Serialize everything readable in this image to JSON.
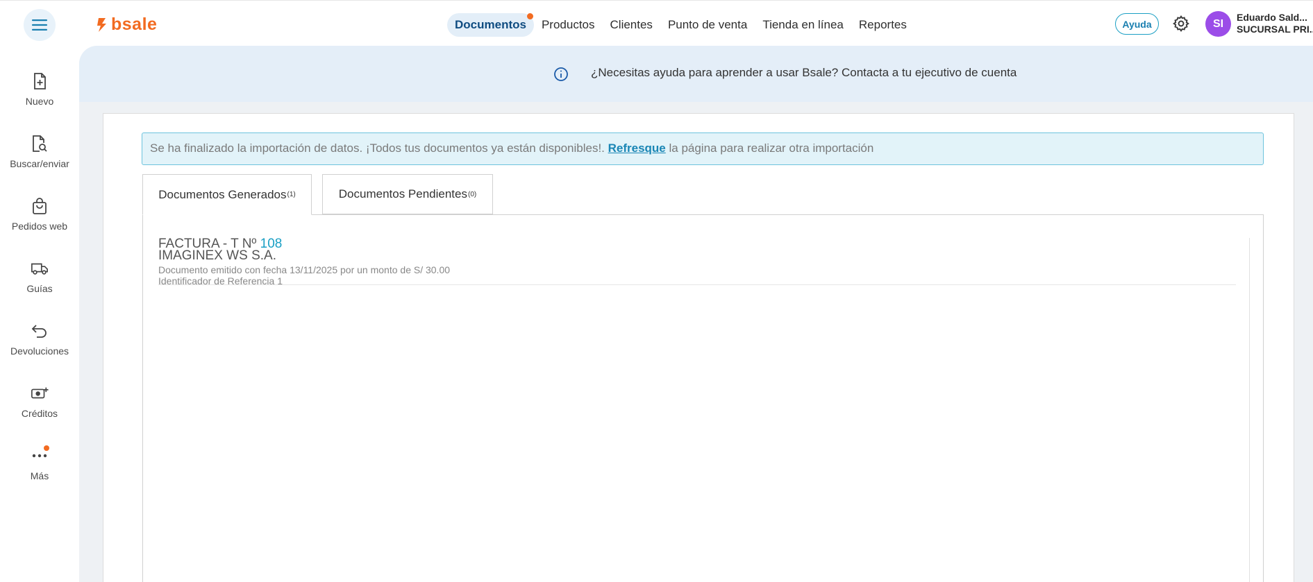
{
  "header": {
    "logo_text": "bsale",
    "nav": [
      {
        "label": "Documentos",
        "active": true,
        "dot": true
      },
      {
        "label": "Productos"
      },
      {
        "label": "Clientes"
      },
      {
        "label": "Punto de venta"
      },
      {
        "label": "Tienda en línea"
      },
      {
        "label": "Reportes"
      }
    ],
    "help_label": "Ayuda",
    "avatar_initials": "SI",
    "user_name": "Eduardo Sald...",
    "user_branch": "SUCURSAL PRI..."
  },
  "sidebar": {
    "items": [
      {
        "label": "Nuevo",
        "icon": "file-plus-icon"
      },
      {
        "label": "Buscar/enviar",
        "icon": "file-search-icon"
      },
      {
        "label": "Pedidos web",
        "icon": "shopping-bag-icon"
      },
      {
        "label": "Guías",
        "icon": "truck-icon"
      },
      {
        "label": "Devoluciones",
        "icon": "return-arrow-icon"
      },
      {
        "label": "Créditos",
        "icon": "money-plus-icon"
      },
      {
        "label": "Más",
        "icon": "more-dots-icon"
      }
    ]
  },
  "banner": {
    "text": "¿Necesitas ayuda para aprender a usar Bsale? Contacta a tu ejecutivo de cuenta"
  },
  "alert": {
    "before": "Se ha finalizado la importación de datos. ¡Todos tus documentos ya están disponibles!. ",
    "link": "Refresque",
    "after": " la página para realizar otra importación"
  },
  "tabs": [
    {
      "label": "Documentos Generados",
      "count": "(1)",
      "active": true
    },
    {
      "label": "Documentos Pendientes",
      "count": "(0)",
      "active": false
    }
  ],
  "documents": [
    {
      "type": "FACTURA - T Nº",
      "number": "108",
      "company": "IMAGINEX WS S.A.",
      "meta": "Documento emitido con fecha 13/11/2025 por un monto de S/ 30.00",
      "reference": "Identificador de Referencia 1"
    }
  ],
  "colors": {
    "brand_orange": "#f26b21",
    "accent_blue": "#1a9fc4",
    "avatar_purple": "#9b4de8"
  }
}
